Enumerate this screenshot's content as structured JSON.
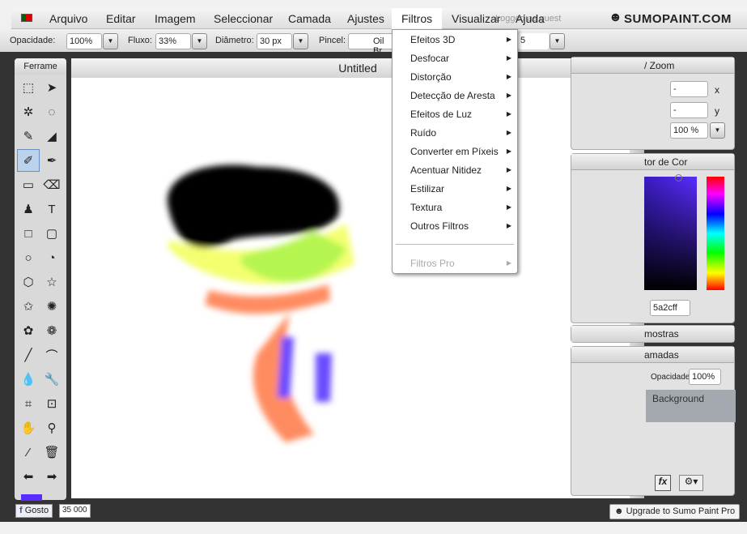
{
  "menubar": {
    "items": [
      "Arquivo",
      "Editar",
      "Imagem",
      "Seleccionar",
      "Camada",
      "Ajustes",
      "Filtros",
      "Visualizar",
      "Ajuda"
    ],
    "login_text": "Logged as guest",
    "logo": "SUMOPAINT.COM"
  },
  "options": {
    "opacity_label": "Opacidade:",
    "opacity": "100%",
    "flow_label": "Fluxo:",
    "flow": "33%",
    "diameter_label": "Diâmetro:",
    "diameter": "30 px",
    "brush_label": "Pincel:",
    "brush": "Oil Br",
    "extra": "5"
  },
  "tools": {
    "title": "Ferrame",
    "icons": [
      "rect-select-icon",
      "move-arrow-icon",
      "magic-wand-icon",
      "lasso-icon",
      "brush-icon",
      "smudge-icon",
      "pencil-icon",
      "pen-icon",
      "gradient-icon",
      "eraser-icon",
      "stamp-icon",
      "text-icon",
      "rectangle-icon",
      "rounded-rect-icon",
      "ellipse-icon",
      "pie-icon",
      "hexagon-icon",
      "star-icon",
      "star-outline-icon",
      "gear-shape-icon",
      "blob-icon",
      "flower-icon",
      "line-icon",
      "curve-icon",
      "drop-icon",
      "wrench-icon",
      "crop-icon",
      "transform-icon",
      "hand-icon",
      "zoom-icon",
      "eyedropper-icon",
      "trash-icon",
      "arrow-left-icon",
      "arrow-right-icon"
    ],
    "glyphs": [
      "⬚",
      "➤",
      "✲",
      "◌",
      "✎",
      "◢",
      "✐",
      "✒",
      "▭",
      "⌫",
      "♟",
      "T",
      "□",
      "▢",
      "○",
      "◔",
      "⬡",
      "☆",
      "✩",
      "✺",
      "✿",
      "❁",
      "╱",
      "⌒",
      "💧",
      "🔧",
      "⌗",
      "⊡",
      "✋",
      "⚲",
      "⁄",
      "🗑",
      "⬅",
      "➡"
    ],
    "fg_color": "#5a2cff"
  },
  "document": {
    "title": "Untitled"
  },
  "filters_menu": {
    "items": [
      "Efeitos 3D",
      "Desfocar",
      "Distorção",
      "Detecção de Aresta",
      "Efeitos de Luz",
      "Ruído",
      "Converter em Píxeis",
      "Acentuar Nitidez",
      "Estilizar",
      "Textura",
      "Outros Filtros"
    ],
    "disabled_item": "Filtros Pro"
  },
  "navigator": {
    "title": "Navegador / Zoom",
    "title_visible": "/ Zoom",
    "x": "-",
    "y": "-",
    "x_label": "x",
    "y_label": "y",
    "zoom": "100 %"
  },
  "color": {
    "title": "tor de Cor",
    "hex": "5a2cff"
  },
  "swatches": {
    "title": "mostras"
  },
  "layers": {
    "title": "amadas",
    "opacity_label": "Opacidade:",
    "opacity": "100%",
    "layer": "Background"
  },
  "footer": {
    "like": "Gosto",
    "like_count": "35 000",
    "upgrade": "Upgrade to Sumo Paint Pro"
  }
}
